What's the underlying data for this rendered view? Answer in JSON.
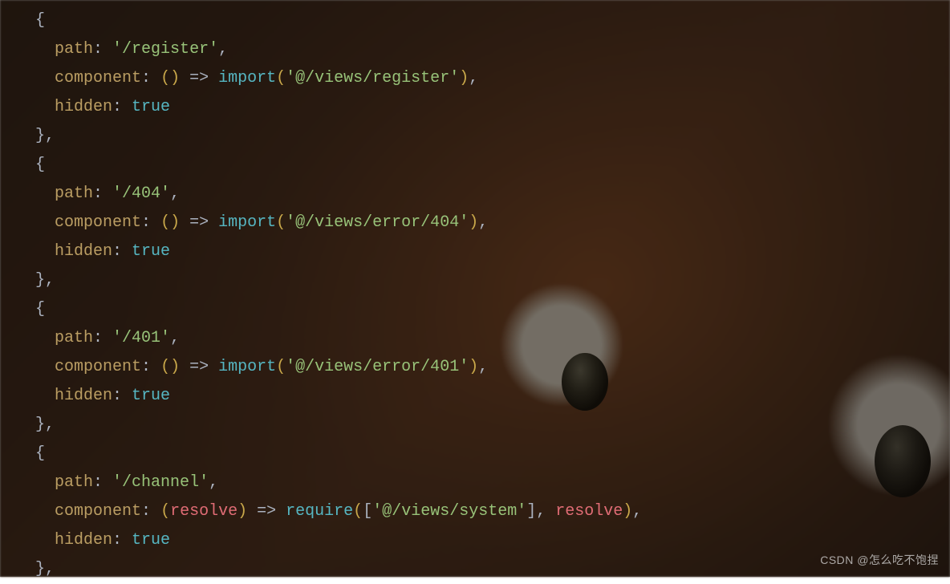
{
  "routes": [
    {
      "path_key": "path",
      "path_value": "'/register'",
      "component_key": "component",
      "arrow_left": "()",
      "arrow": "=>",
      "call_name": "import",
      "call_arg": "'@/views/register'",
      "hidden_key": "hidden",
      "hidden_value": "true",
      "is_require": false
    },
    {
      "path_key": "path",
      "path_value": "'/404'",
      "component_key": "component",
      "arrow_left": "()",
      "arrow": "=>",
      "call_name": "import",
      "call_arg": "'@/views/error/404'",
      "hidden_key": "hidden",
      "hidden_value": "true",
      "is_require": false
    },
    {
      "path_key": "path",
      "path_value": "'/401'",
      "component_key": "component",
      "arrow_left": "()",
      "arrow": "=>",
      "call_name": "import",
      "call_arg": "'@/views/error/401'",
      "hidden_key": "hidden",
      "hidden_value": "true",
      "is_require": false
    },
    {
      "path_key": "path",
      "path_value": "'/channel'",
      "component_key": "component",
      "arrow_param": "resolve",
      "arrow": "=>",
      "call_name": "require",
      "require_arr": "'@/views/system'",
      "require_second": "resolve",
      "hidden_key": "hidden",
      "hidden_value": "true",
      "is_require": true
    }
  ],
  "watermark": "CSDN @怎么吃不饱捏"
}
